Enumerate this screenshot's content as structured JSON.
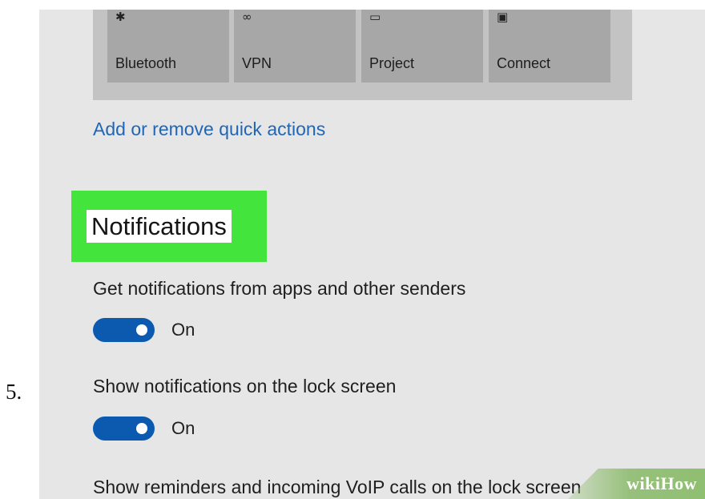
{
  "step_number": "5.",
  "quick_actions": {
    "tiles": [
      {
        "label": "Bluetooth",
        "icon": "bluetooth-icon",
        "glyph": "✱"
      },
      {
        "label": "VPN",
        "icon": "vpn-icon",
        "glyph": "∞"
      },
      {
        "label": "Project",
        "icon": "project-icon",
        "glyph": "▭"
      },
      {
        "label": "Connect",
        "icon": "connect-icon",
        "glyph": "▣"
      }
    ],
    "add_remove_link": "Add or remove quick actions"
  },
  "notifications": {
    "heading": "Notifications",
    "settings": [
      {
        "label": "Get notifications from apps and other senders",
        "state": "On"
      },
      {
        "label": "Show notifications on the lock screen",
        "state": "On"
      },
      {
        "label": "Show reminders and incoming VoIP calls on the lock screen"
      }
    ]
  },
  "watermark": "wikiHow",
  "colors": {
    "accent_toggle": "#0b5ab0",
    "link": "#1f66b8",
    "highlight": "#43e43c"
  }
}
